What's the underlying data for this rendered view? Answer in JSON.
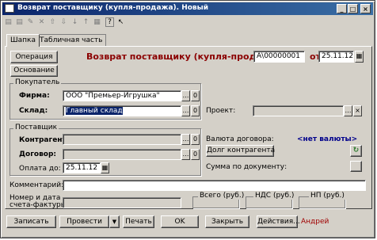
{
  "window": {
    "title": "Возврат поставщику (купля-продажа). Новый"
  },
  "tabs": [
    "Шапка",
    "Табличная часть"
  ],
  "header": {
    "operation_button": "Операция",
    "basis_button": "Основание",
    "doc_title": "Возврат поставщику (купля-продажа) №",
    "doc_number": "А\\00000001",
    "from_label": "от",
    "date": "25.11.12"
  },
  "buyer": {
    "group_title": "Покупатель",
    "firm_label": "Фирма:",
    "firm_value": "ООО \"Премьер-Игрушка\"",
    "warehouse_label": "Склад:",
    "warehouse_value": "Главный склад",
    "project_label": "Проект:",
    "project_value": ""
  },
  "supplier": {
    "group_title": "Поставщик",
    "contractor_label": "Контрагент:",
    "contract_label": "Договор:",
    "payment_label": "Оплата до:",
    "payment_date": "25.11.12",
    "currency_label": "Валюта договора:",
    "currency_value": "<нет валюты>",
    "debt_button": "Долг контрагента",
    "sum_label": "Сумма по документу:"
  },
  "comment_label": "Комментарий:",
  "invoice_label_1": "Номер и дата",
  "invoice_label_2": "счета-фактуры:",
  "totals": {
    "total": "Всего (руб.)",
    "vat": "НДС (руб.)",
    "np": "НП (руб.)"
  },
  "footer": {
    "save": "Записать",
    "post": "Провести",
    "print": "Печать",
    "ok": "OK",
    "close": "Закрыть",
    "actions": "Действия...",
    "user": "Андрей"
  },
  "colors": {
    "title_red": "#8b0000",
    "currency_blue": "#00008b",
    "user_red": "#a00000"
  }
}
